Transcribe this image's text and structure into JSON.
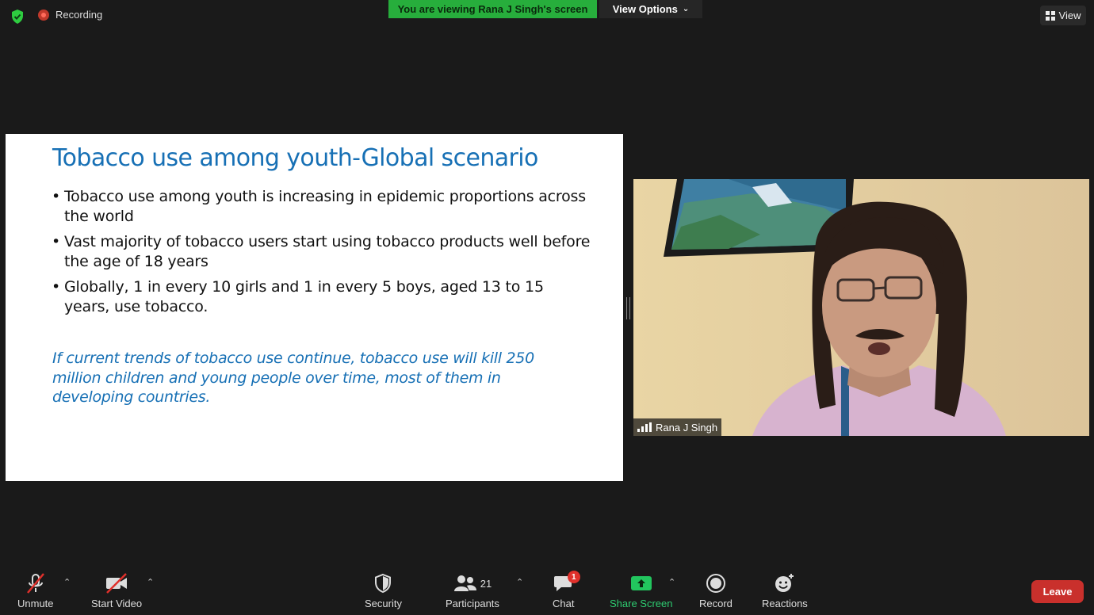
{
  "top_bar": {
    "recording_label": "Recording",
    "viewing_banner": "You are viewing Rana J Singh's screen",
    "view_options_label": "View Options",
    "view_label": "View"
  },
  "slide": {
    "title": "Tobacco use among youth-Global scenario",
    "bullets": [
      "Tobacco use among youth is increasing in epidemic proportions across the world",
      "Vast majority of tobacco users start using tobacco products well before the age of 18 years",
      "Globally, 1 in every 10 girls and 1 in every 5 boys, aged 13 to 15 years, use tobacco."
    ],
    "quote": "If current trends of tobacco use continue, tobacco use will kill 250 million children and young people over time, most of them in developing countries."
  },
  "video": {
    "participant_name": "Rana J Singh"
  },
  "toolbar": {
    "unmute_label": "Unmute",
    "start_video_label": "Start Video",
    "security_label": "Security",
    "participants_label": "Participants",
    "participants_count": "21",
    "chat_label": "Chat",
    "chat_badge": "1",
    "share_screen_label": "Share Screen",
    "record_label": "Record",
    "reactions_label": "Reactions",
    "leave_label": "Leave"
  },
  "colors": {
    "banner_green": "#27ae3c",
    "slide_blue": "#1770b5",
    "leave_red": "#c9302c",
    "share_green": "#22c55e"
  }
}
